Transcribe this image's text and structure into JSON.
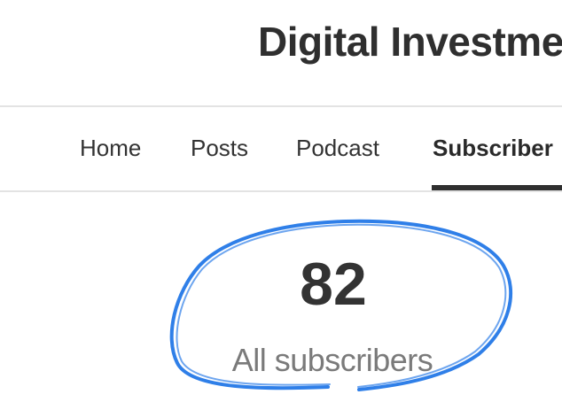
{
  "header": {
    "site_title": "Digital Investme"
  },
  "nav": {
    "items": [
      {
        "label": "Home"
      },
      {
        "label": "Posts"
      },
      {
        "label": "Podcast"
      },
      {
        "label": "Subscriber",
        "active": true
      }
    ]
  },
  "stats": {
    "count": "82",
    "label": "All subscribers"
  },
  "colors": {
    "text_dark": "#333333",
    "text_muted": "#7a7a7a",
    "divider": "#e3e3e3",
    "annotation_blue": "#2f7fe8"
  }
}
